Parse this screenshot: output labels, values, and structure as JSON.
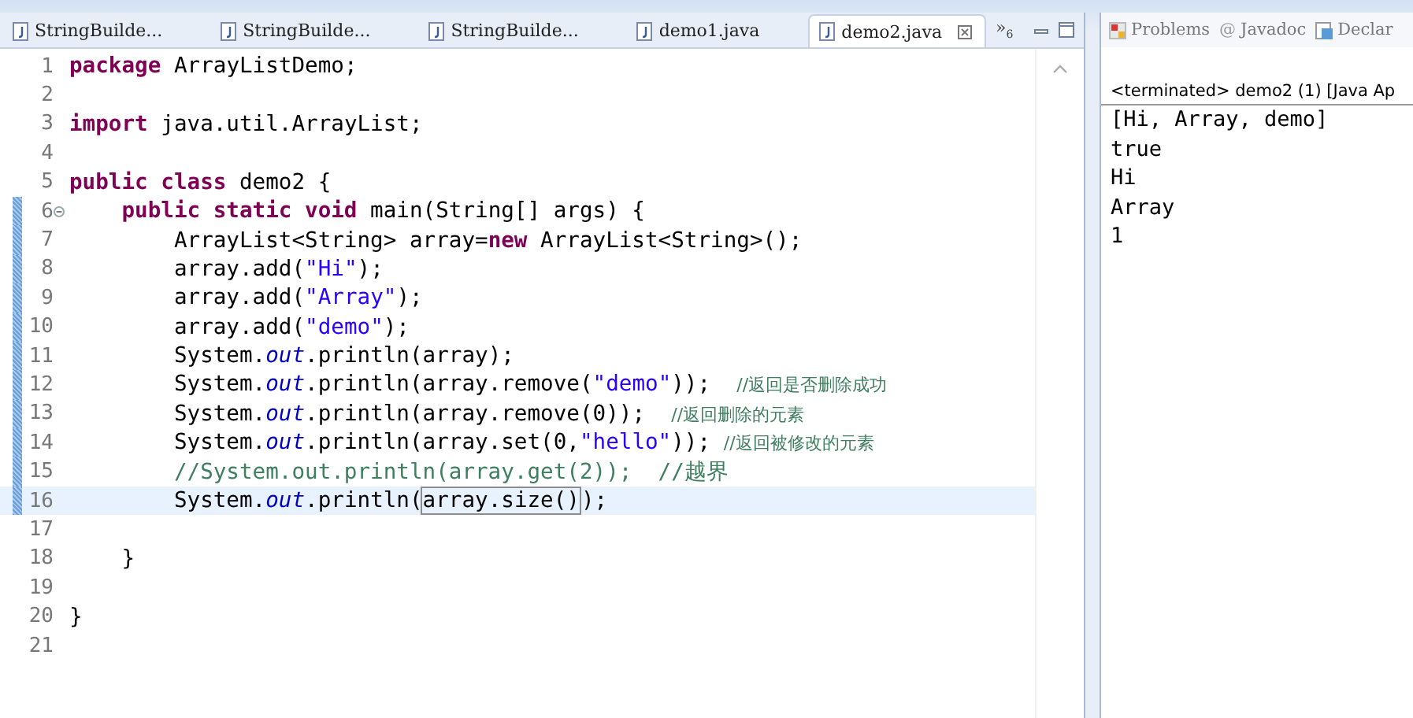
{
  "editor": {
    "tabs": [
      {
        "label": "StringBuilde...",
        "selected": false,
        "closable": false
      },
      {
        "label": "StringBuilde...",
        "selected": false,
        "closable": false
      },
      {
        "label": "StringBuilde...",
        "selected": false,
        "closable": false
      },
      {
        "label": "demo1.java",
        "selected": false,
        "closable": false
      },
      {
        "label": "demo2.java",
        "selected": true,
        "closable": true
      }
    ],
    "overflow": {
      "symbol": "»",
      "count": "6"
    },
    "lines": [
      {
        "number": "1",
        "changed": false,
        "current": false,
        "fold": false,
        "tokens": [
          {
            "kind": "keyword",
            "text": "package"
          },
          {
            "kind": "plain",
            "text": " ArrayListDemo;"
          }
        ]
      },
      {
        "number": "2",
        "changed": false,
        "current": false,
        "fold": false
      },
      {
        "number": "3",
        "changed": false,
        "current": false,
        "fold": false,
        "tokens": [
          {
            "kind": "keyword",
            "text": "import"
          },
          {
            "kind": "plain",
            "text": " java.util.ArrayList;"
          }
        ]
      },
      {
        "number": "4",
        "changed": false,
        "current": false,
        "fold": false
      },
      {
        "number": "5",
        "changed": false,
        "current": false,
        "fold": false,
        "tokens": [
          {
            "kind": "keyword",
            "text": "public class"
          },
          {
            "kind": "plain",
            "text": " demo2 {"
          }
        ]
      },
      {
        "number": "6",
        "changed": true,
        "current": false,
        "fold": true,
        "tokens": [
          {
            "kind": "keyword",
            "text": "    public static void"
          },
          {
            "kind": "plain",
            "text": " main(String[] args) {"
          }
        ]
      },
      {
        "number": "7",
        "changed": true,
        "current": false,
        "fold": false,
        "tokens": [
          {
            "kind": "plain",
            "text": "        ArrayList<String> array="
          },
          {
            "kind": "keyword",
            "text": "new"
          },
          {
            "kind": "plain",
            "text": " ArrayList<String>();"
          }
        ]
      },
      {
        "number": "8",
        "changed": true,
        "current": false,
        "fold": false,
        "tokens": [
          {
            "kind": "plain",
            "text": "        array.add("
          },
          {
            "kind": "string",
            "text": "\"Hi\""
          },
          {
            "kind": "plain",
            "text": ");"
          }
        ]
      },
      {
        "number": "9",
        "changed": true,
        "current": false,
        "fold": false,
        "tokens": [
          {
            "kind": "plain",
            "text": "        array.add("
          },
          {
            "kind": "string",
            "text": "\"Array\""
          },
          {
            "kind": "plain",
            "text": ");"
          }
        ]
      },
      {
        "number": "10",
        "changed": true,
        "current": false,
        "fold": false,
        "tokens": [
          {
            "kind": "plain",
            "text": "        array.add("
          },
          {
            "kind": "string",
            "text": "\"demo\""
          },
          {
            "kind": "plain",
            "text": ");"
          }
        ]
      },
      {
        "number": "11",
        "changed": true,
        "current": false,
        "fold": false,
        "tokens": [
          {
            "kind": "plain",
            "text": "        System."
          },
          {
            "kind": "field",
            "text": "out"
          },
          {
            "kind": "plain",
            "text": ".println(array);"
          }
        ]
      },
      {
        "number": "12",
        "changed": true,
        "current": false,
        "fold": false,
        "tokens": [
          {
            "kind": "plain",
            "text": "        System."
          },
          {
            "kind": "field",
            "text": "out"
          },
          {
            "kind": "plain",
            "text": ".println(array.remove("
          },
          {
            "kind": "string",
            "text": "\"demo\""
          },
          {
            "kind": "plain",
            "text": "));  "
          },
          {
            "kind": "comment",
            "text": "//返回是否删除成功"
          }
        ]
      },
      {
        "number": "13",
        "changed": true,
        "current": false,
        "fold": false,
        "tokens": [
          {
            "kind": "plain",
            "text": "        System."
          },
          {
            "kind": "field",
            "text": "out"
          },
          {
            "kind": "plain",
            "text": ".println(array.remove(0));  "
          },
          {
            "kind": "comment",
            "text": "//返回删除的元素"
          }
        ]
      },
      {
        "number": "14",
        "changed": true,
        "current": false,
        "fold": false,
        "tokens": [
          {
            "kind": "plain",
            "text": "        System."
          },
          {
            "kind": "field",
            "text": "out"
          },
          {
            "kind": "plain",
            "text": ".println(array.set(0,"
          },
          {
            "kind": "string",
            "text": "\"hello\""
          },
          {
            "kind": "plain",
            "text": ")); "
          },
          {
            "kind": "comment",
            "text": "//返回被修改的元素"
          }
        ]
      },
      {
        "number": "15",
        "changed": true,
        "current": false,
        "fold": false,
        "tokens": [
          {
            "kind": "comment",
            "text": "        //System.out.println(array.get(2));  //越界"
          }
        ]
      },
      {
        "number": "16",
        "changed": true,
        "current": true,
        "fold": false,
        "tokens": [
          {
            "kind": "plain",
            "text": "        System."
          },
          {
            "kind": "field",
            "text": "out"
          },
          {
            "kind": "plain",
            "text": ".println("
          },
          {
            "kind": "matched",
            "text": "array.size()"
          },
          {
            "kind": "plain",
            "text": ");"
          }
        ]
      },
      {
        "number": "17",
        "changed": false,
        "current": false,
        "fold": false
      },
      {
        "number": "18",
        "changed": false,
        "current": false,
        "fold": false,
        "tokens": [
          {
            "kind": "plain",
            "text": "    }"
          }
        ]
      },
      {
        "number": "19",
        "changed": false,
        "current": false,
        "fold": false
      },
      {
        "number": "20",
        "changed": false,
        "current": false,
        "fold": false,
        "tokens": [
          {
            "kind": "plain",
            "text": "}"
          }
        ]
      },
      {
        "number": "21",
        "changed": false,
        "current": false,
        "fold": false
      }
    ]
  },
  "console": {
    "tabs": [
      {
        "label": "Problems",
        "kind": "problems"
      },
      {
        "label": "Javadoc",
        "kind": "javadoc",
        "glyph": "@"
      },
      {
        "label": "Declar",
        "kind": "declaration"
      }
    ],
    "header": "<terminated> demo2 (1) [Java Ap",
    "output": [
      "[Hi, Array, demo]",
      "true",
      "Hi",
      "Array",
      "1"
    ]
  }
}
